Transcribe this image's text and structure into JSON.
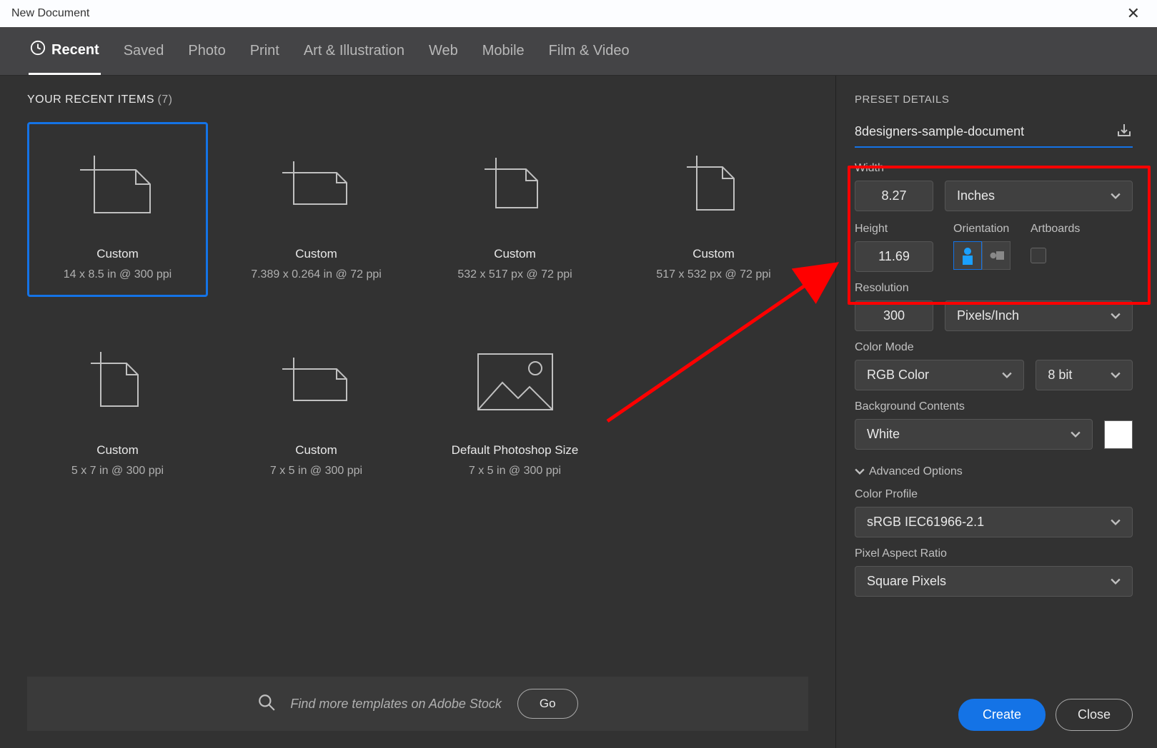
{
  "titlebar": {
    "title": "New Document"
  },
  "tabs": [
    {
      "label": "Recent",
      "active": true
    },
    {
      "label": "Saved"
    },
    {
      "label": "Photo"
    },
    {
      "label": "Print"
    },
    {
      "label": "Art & Illustration"
    },
    {
      "label": "Web"
    },
    {
      "label": "Mobile"
    },
    {
      "label": "Film & Video"
    }
  ],
  "recent": {
    "heading": "YOUR RECENT ITEMS",
    "count": "(7)"
  },
  "presets": [
    {
      "name": "Custom",
      "specs": "14 x 8.5 in @ 300 ppi",
      "selected": true,
      "icon": "doc"
    },
    {
      "name": "Custom",
      "specs": "7.389 x 0.264 in @ 72 ppi",
      "icon": "doc"
    },
    {
      "name": "Custom",
      "specs": "532 x 517 px @ 72 ppi",
      "icon": "doc"
    },
    {
      "name": "Custom",
      "specs": "517 x 532 px @ 72 ppi",
      "icon": "doc"
    },
    {
      "name": "Custom",
      "specs": "5 x 7 in @ 300 ppi",
      "icon": "doc"
    },
    {
      "name": "Custom",
      "specs": "7 x 5 in @ 300 ppi",
      "icon": "doc"
    },
    {
      "name": "Default Photoshop Size",
      "specs": "7 x 5 in @ 300 ppi",
      "icon": "image"
    }
  ],
  "search": {
    "placeholder": "Find more templates on Adobe Stock",
    "go_label": "Go"
  },
  "details": {
    "heading": "PRESET DETAILS",
    "name": "8designers-sample-document",
    "width_label": "Width",
    "width_value": "8.27",
    "units_value": "Inches",
    "height_label": "Height",
    "height_value": "11.69",
    "orientation_label": "Orientation",
    "artboards_label": "Artboards",
    "resolution_label": "Resolution",
    "resolution_value": "300",
    "resolution_units": "Pixels/Inch",
    "color_mode_label": "Color Mode",
    "color_mode_value": "RGB Color",
    "color_depth_value": "8 bit",
    "bg_label": "Background Contents",
    "bg_value": "White",
    "advanced_label": "Advanced Options",
    "color_profile_label": "Color Profile",
    "color_profile_value": "sRGB IEC61966-2.1",
    "par_label": "Pixel Aspect Ratio",
    "par_value": "Square Pixels"
  },
  "buttons": {
    "create": "Create",
    "close": "Close"
  }
}
